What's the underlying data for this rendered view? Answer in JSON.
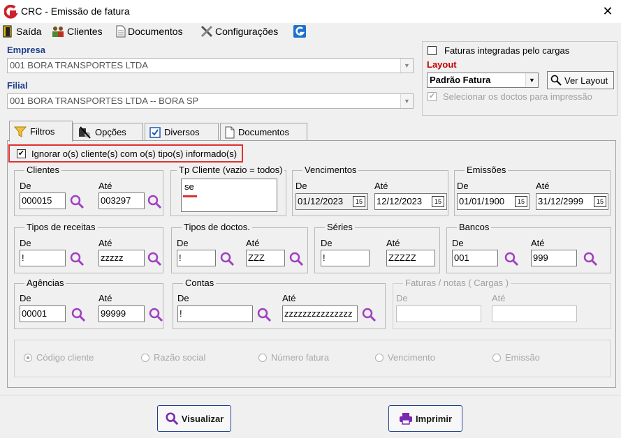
{
  "window": {
    "title": "CRC - Emissão de fatura",
    "close": "✕"
  },
  "menu": {
    "saida": "Saída",
    "clientes": "Clientes",
    "documentos": "Documentos",
    "configuracoes": "Configurações"
  },
  "empresa": {
    "label": "Empresa",
    "value": "001 BORA TRANSPORTES LTDA"
  },
  "filial": {
    "label": "Filial",
    "value": "001 BORA TRANSPORTES LTDA -- BORA SP"
  },
  "faturas_integradas": "Faturas integradas pelo cargas",
  "layout": {
    "label": "Layout",
    "value": "Padrão Fatura",
    "ver_layout": "Ver Layout"
  },
  "selecionar_doctos": "Selecionar os doctos para impressão",
  "tabs": [
    {
      "label": "Filtros"
    },
    {
      "label": "Opções"
    },
    {
      "label": "Diversos"
    },
    {
      "label": "Documentos"
    }
  ],
  "ignorar_clientes": "Ignorar o(s) cliente(s) com o(s) tipo(s) informado(s)",
  "common": {
    "de": "De",
    "ate": "Até"
  },
  "clientes": {
    "title": "Clientes",
    "de": "000015",
    "ate": "003297"
  },
  "tp_cliente": {
    "title": "Tp Cliente (vazio = todos)",
    "value": "se"
  },
  "vencimentos": {
    "title": "Vencimentos",
    "de": "01/12/2023",
    "ate": "12/12/2023"
  },
  "emissoes": {
    "title": "Emissões",
    "de": "01/01/1900",
    "ate": "31/12/2999"
  },
  "tipos_receitas": {
    "title": "Tipos de receitas",
    "de": "!",
    "ate": "zzzzz"
  },
  "tipos_doctos": {
    "title": "Tipos de doctos.",
    "de": "!",
    "ate": "ZZZ"
  },
  "series": {
    "title": "Séries",
    "de": "!",
    "ate": "ZZZZZ"
  },
  "bancos": {
    "title": "Bancos",
    "de": "001",
    "ate": "999"
  },
  "agencias": {
    "title": "Agências",
    "de": "00001",
    "ate": "99999"
  },
  "contas": {
    "title": "Contas",
    "de": "!",
    "ate": "zzzzzzzzzzzzzzz"
  },
  "faturas_notas": {
    "title": "Faturas / notas ( Cargas )"
  },
  "ordem": {
    "codigo_cliente": "Código cliente",
    "razao_social": "Razão social",
    "numero_fatura": "Número fatura",
    "vencimento": "Vencimento",
    "emissao": "Emissão"
  },
  "buttons": {
    "visualizar": "Visualizar",
    "imprimir": "Imprimir"
  },
  "colors": {
    "accent_blue": "#1f3f8c",
    "highlight_red": "#e03030",
    "layout_red": "#c00000",
    "search_purple": "#a040c0"
  }
}
